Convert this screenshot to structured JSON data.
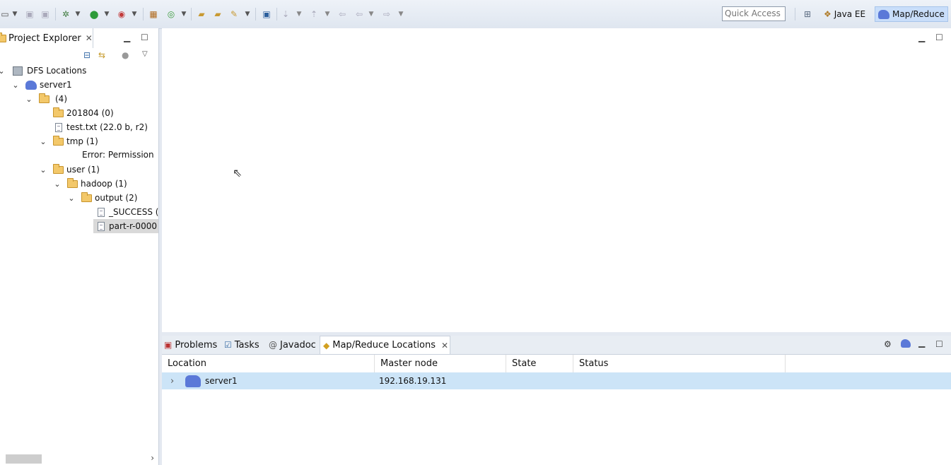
{
  "toolbar": {
    "quick_access_placeholder": "Quick Access",
    "perspectives": [
      {
        "label": "Java EE",
        "icon": "java-ee-perspective-icon"
      },
      {
        "label": "Map/Reduce",
        "icon": "elephant-icon",
        "active": true
      }
    ]
  },
  "project_explorer": {
    "title": "Project Explorer",
    "tree": [
      {
        "label": "DFS Locations",
        "icon": "dfs-icon",
        "level": 0
      },
      {
        "label": "server1",
        "icon": "elephant-icon",
        "level": 1
      },
      {
        "label": "(4)",
        "icon": "folder-icon",
        "level": 2
      },
      {
        "label": "201804 (0)",
        "icon": "folder-icon",
        "level": 3
      },
      {
        "label": "test.txt (22.0 b, r2)",
        "icon": "file-icon",
        "level": 3
      },
      {
        "label": "tmp (1)",
        "icon": "folder-icon",
        "level": 3
      },
      {
        "label": "Error: Permission",
        "icon": "",
        "level": 4
      },
      {
        "label": "user (1)",
        "icon": "folder-icon",
        "level": 3
      },
      {
        "label": "hadoop (1)",
        "icon": "folder-icon",
        "level": 4
      },
      {
        "label": "output (2)",
        "icon": "folder-icon",
        "level": 5
      },
      {
        "label": "_SUCCESS (",
        "icon": "file-icon",
        "level": 6
      },
      {
        "label": "part-r-0000",
        "icon": "file-icon",
        "level": 6,
        "selected": true
      }
    ]
  },
  "bottom_panel": {
    "tabs": [
      {
        "label": "Problems",
        "icon": "problems-icon"
      },
      {
        "label": "Tasks",
        "icon": "tasks-icon"
      },
      {
        "label": "Javadoc",
        "icon": "javadoc-icon"
      },
      {
        "label": "Map/Reduce Locations",
        "icon": "mapreduce-locations-icon",
        "active": true
      }
    ],
    "columns": [
      "Location",
      "Master node",
      "State",
      "Status"
    ],
    "rows": [
      {
        "location": "server1",
        "master_node": "192.168.19.131",
        "state": "",
        "status": ""
      }
    ]
  }
}
